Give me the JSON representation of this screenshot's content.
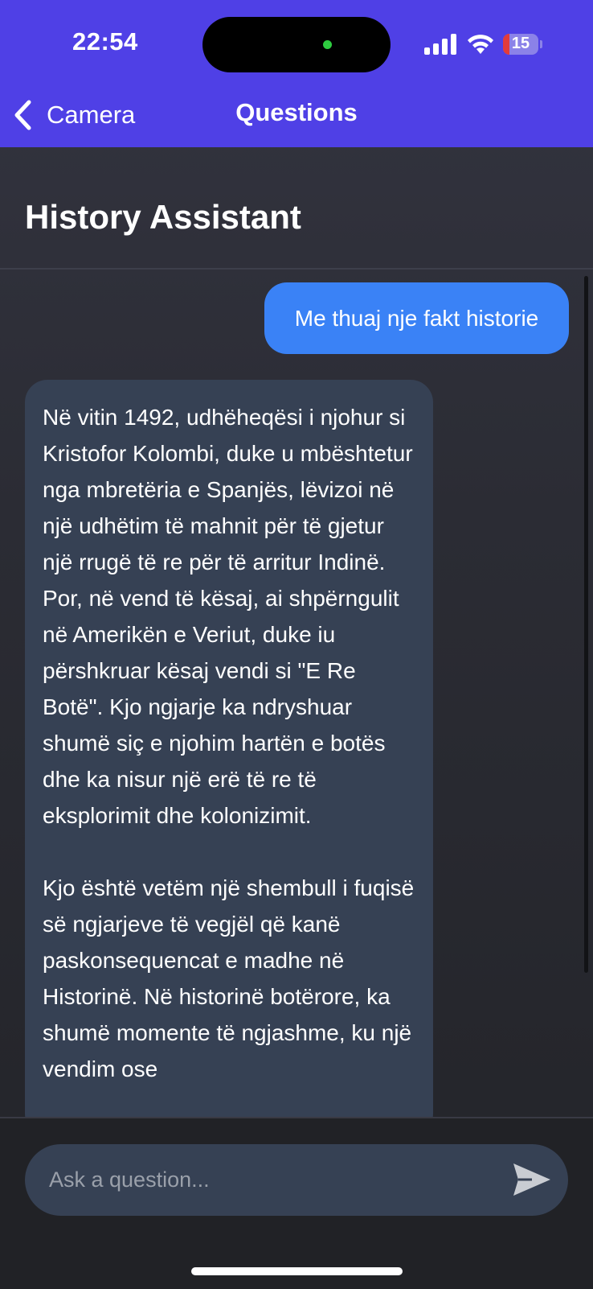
{
  "status_bar": {
    "time": "22:54",
    "battery_level": "15",
    "icons": [
      "signal-icon",
      "wifi-icon",
      "battery-icon"
    ]
  },
  "nav": {
    "back_label": "Camera",
    "back_icon": "chevron-left-icon",
    "title": "Questions"
  },
  "page": {
    "title": "History Assistant"
  },
  "messages": [
    {
      "role": "user",
      "text": "Me thuaj nje fakt historie"
    },
    {
      "role": "assistant",
      "text": "Në vitin 1492, udhëheqësi i njohur si Kristofor Kolombi, duke u mbështetur nga mbretëria e Spanjës, lëvizoi në një udhëtim të mahnit për të gjetur një rrugë të re për të arritur Indinë. Por, në vend të kësaj, ai shpërngulit në Amerikën e Veriut, duke iu përshkruar kësaj vendi si \"E Re Botë\". Kjo ngjarje ka ndryshuar shumë siç e njohim hartën e botës dhe ka nisur një erë të re të eksplorimit dhe kolonizimit.\n\nKjo është vetëm një shembull i fuqisë së ngjarjeve të vegjël që kanë paskonsequencat e madhe në Historinë. Në historinë botërore, ka shumë momente të ngjashme, ku një vendim ose"
    }
  ],
  "composer": {
    "placeholder": "Ask a question...",
    "send_icon": "send-icon"
  },
  "colors": {
    "header": "#4f40e6",
    "user_bubble": "#3a82f6",
    "assistant_bubble": "#364154",
    "background": "#2b2c34"
  }
}
